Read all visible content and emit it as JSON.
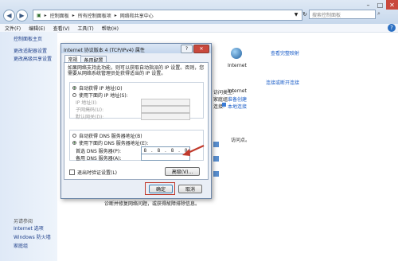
{
  "window": {
    "minimize": "–",
    "maximize": "□",
    "close": "✕"
  },
  "address": {
    "segments": [
      "▸",
      "控制面板",
      "▸",
      "所有控制面板项",
      "▸",
      "网络和共享中心"
    ],
    "search_placeholder": "搜索控制面板"
  },
  "menu": [
    "文件(F)",
    "编辑(E)",
    "查看(V)",
    "工具(T)",
    "帮助(H)"
  ],
  "leftpane": {
    "home": "控制面板主页",
    "links": [
      "更改适配器设置",
      "更改高级共享设置"
    ],
    "see_also_title": "另请参阅",
    "see_also": [
      "Internet 选项",
      "Windows 防火墙",
      "家庭组"
    ]
  },
  "main": {
    "view_full_map": "查看完整映射",
    "internet_label": "Internet",
    "connect_disconnect": "连接或断开连接",
    "access_type_label": "访问类型:",
    "access_type_value": "Internet",
    "homegroup_label": "家庭组:",
    "homegroup_value": "准备创建",
    "connections_label": "连接:",
    "connections_value": "本地连接",
    "fragment_1": "访问点。",
    "bottom_text": "诊断并修复网络问题，或获得故障排除信息。"
  },
  "dialog": {
    "title": "Internet 协议版本 4 (TCP/IPv4) 属性",
    "help_button": "?",
    "close_button": "✕",
    "tabs": [
      "常规",
      "备用配置"
    ],
    "description": "如果网络支持此功能，则可以获取自动指派的 IP 设置。否则，您需要从网络系统管理员处获得适当的 IP 设置。",
    "auto_ip": "自动获得 IP 地址(O)",
    "manual_ip": "使用下面的 IP 地址(S):",
    "ip_address_label": "IP 地址(I):",
    "subnet_label": "子网掩码(U):",
    "gateway_label": "默认网关(D):",
    "auto_dns": "自动获得 DNS 服务器地址(B)",
    "manual_dns": "使用下面的 DNS 服务器地址(E):",
    "preferred_dns_label": "首选 DNS 服务器(P):",
    "alternate_dns_label": "备用 DNS 服务器(A):",
    "preferred_dns_octets": [
      "8",
      "8",
      "8",
      "8"
    ],
    "validate_label": "退出时验证设置(L)",
    "advanced_button": "高级(V)...",
    "ok_button": "确定",
    "cancel_button": "取消"
  },
  "colors": {
    "annotation": "#c0392b",
    "link": "#1a5dc8"
  }
}
